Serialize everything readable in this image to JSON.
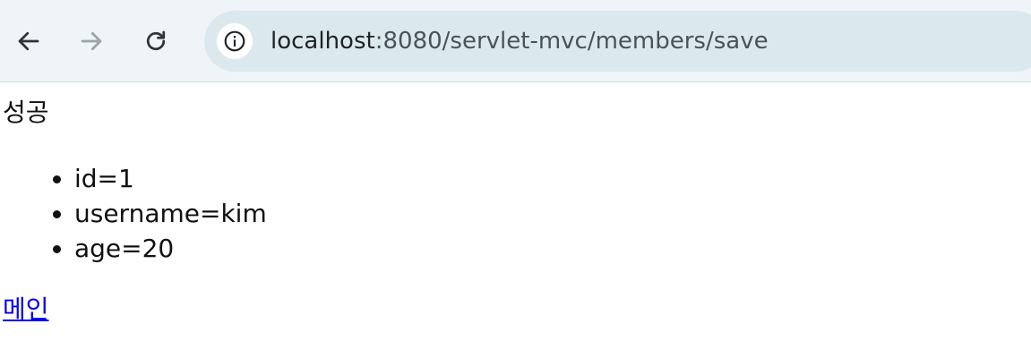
{
  "browser": {
    "url_host": "localhost",
    "url_rest": ":8080/servlet-mvc/members/save"
  },
  "page": {
    "status": "성공",
    "fields": [
      "id=1",
      "username=kim",
      "age=20"
    ],
    "main_link": "메인"
  },
  "icons": {
    "back": "arrow-left-icon",
    "forward": "arrow-right-icon",
    "reload": "reload-icon",
    "site_info": "info-icon"
  },
  "colors": {
    "toolbar_bg": "#eef4f8",
    "omnibox_bg": "#dbe9ee",
    "link": "#0000ee",
    "text": "#111111"
  }
}
